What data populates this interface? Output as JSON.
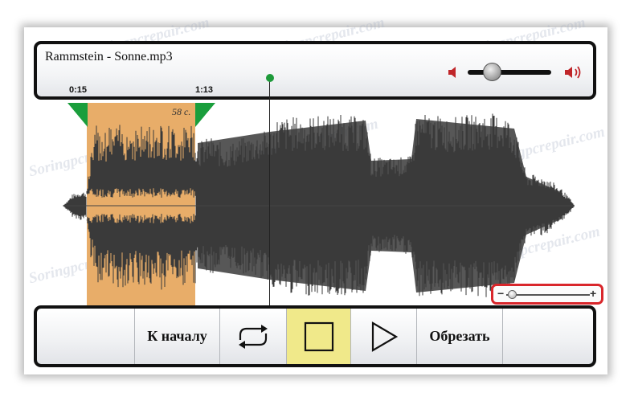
{
  "player": {
    "file_title": "Rammstein - Sonne.mp3",
    "selection_start": "0:15",
    "selection_end": "1:13",
    "selection_length": "58 с.",
    "volume_level": 0.28,
    "zoom_level": 0.05
  },
  "toolbar": {
    "to_start_label": "К началу",
    "trim_label": "Обрезать"
  },
  "watermark": "Soringpcrepair.com",
  "colors": {
    "selection": "#e8ad69",
    "marker_green": "#1a9e3c",
    "waveform": "#3a3a3a",
    "active_button": "#f0e98a",
    "highlight_red": "#d9262b",
    "speaker_red": "#c0262a"
  }
}
